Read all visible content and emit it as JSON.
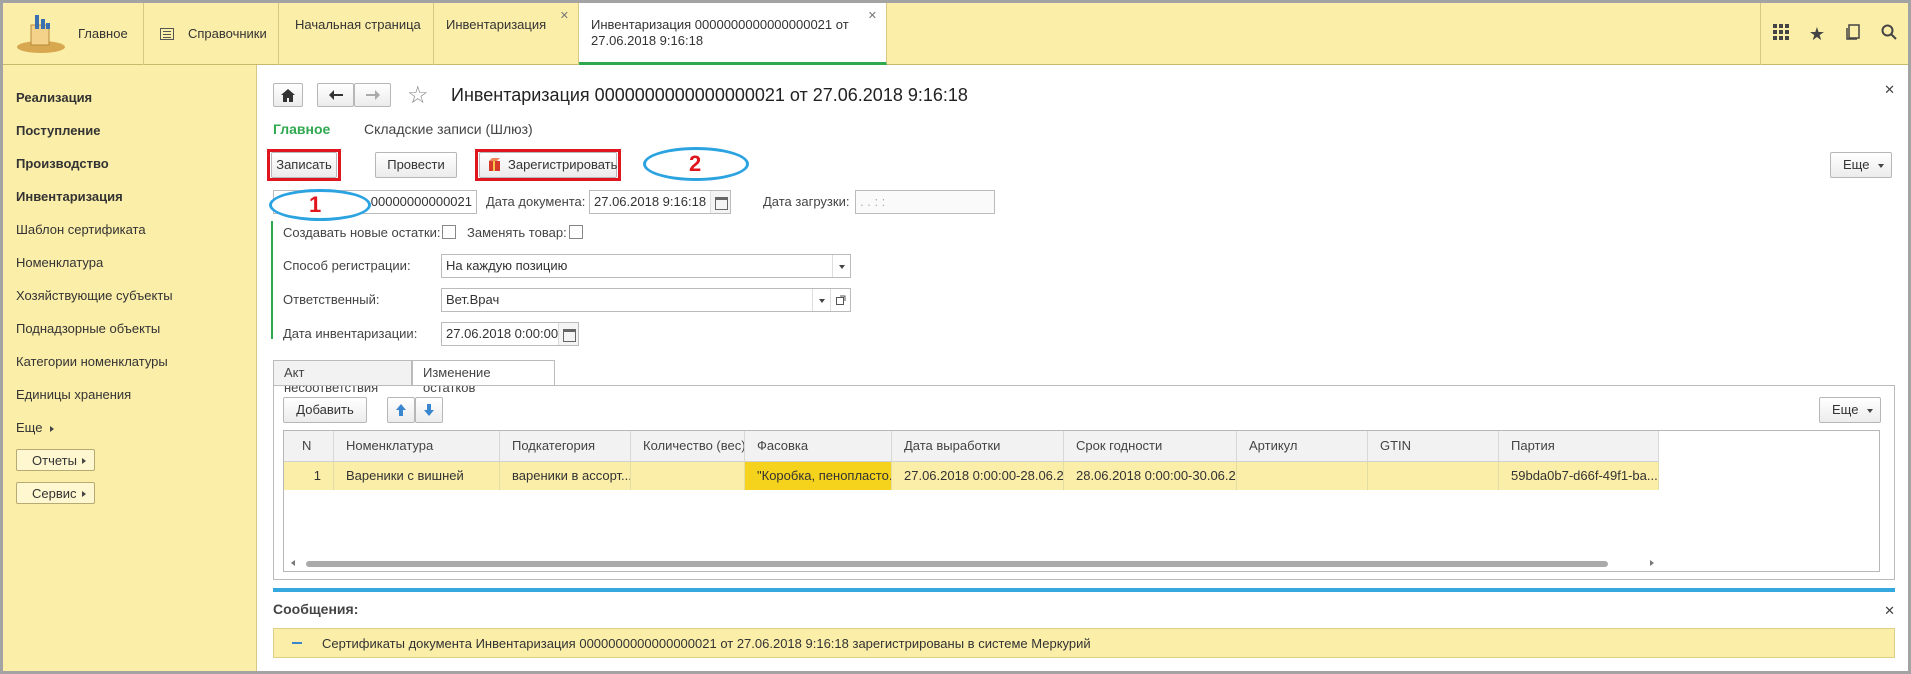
{
  "topbar": {
    "main_label": "Главное",
    "sections_label": "Справочники",
    "tabs": [
      {
        "label": "Начальная страница"
      },
      {
        "label": "Инвентаризация"
      },
      {
        "label": "Инвентаризация 0000000000000000021 от 27.06.2018 9:16:18"
      }
    ],
    "icons": [
      "grid-icon",
      "star-icon",
      "history-icon",
      "search-icon"
    ]
  },
  "sidebar": {
    "items": [
      {
        "label": "Реализация"
      },
      {
        "label": "Поступление"
      },
      {
        "label": "Производство"
      },
      {
        "label": "Инвентаризация"
      },
      {
        "label": "Шаблон сертификата"
      },
      {
        "label": "Номенклатура"
      },
      {
        "label": "Хозяйствующие субъекты"
      },
      {
        "label": "Поднадзорные объекты"
      },
      {
        "label": "Категории номенклатуры"
      },
      {
        "label": "Единицы хранения"
      },
      {
        "label": "Еще"
      }
    ],
    "reports_label": "Отчеты",
    "service_label": "Сервис"
  },
  "document": {
    "title": "Инвентаризация 0000000000000000021 от 27.06.2018 9:16:18",
    "nav_main": "Главное",
    "nav_records": "Складские записи (Шлюз)",
    "toolbar": {
      "save_label": "Записать",
      "post_label": "Провести",
      "register_label": "Зарегистрировать",
      "more_label": "Еще"
    },
    "annotations": {
      "one": "1",
      "two": "2"
    },
    "number_value": "00000000000021",
    "date_label": "Дата документа:",
    "date_value": "27.06.2018  9:16:18",
    "load_date_label": "Дата загрузки:",
    "load_date_value": " .  .       :  :",
    "create_new_label": "Создавать новые остатки:",
    "replace_label": "Заменять товар:",
    "reg_method_label": "Способ регистрации:",
    "reg_method_value": "На каждую позицию",
    "responsible_label": "Ответственный:",
    "responsible_value": "Вет.Врач",
    "inv_date_label": "Дата инвентаризации:",
    "inv_date_value": "27.06.2018  0:00:00"
  },
  "tabs": {
    "discrepancy_label": "Акт несоответствия",
    "changes_label": "Изменение остатков"
  },
  "table_toolbar": {
    "add_label": "Добавить",
    "more_label": "Еще"
  },
  "table": {
    "columns": [
      "N",
      "Номенклатура",
      "Подкатегория",
      "Количество (вес)",
      "Фасовка",
      "Дата выработки",
      "Срок годности",
      "Артикул",
      "GTIN",
      "Партия"
    ],
    "rows": [
      {
        "n": "1",
        "nomenclature": "Вареники с вишней",
        "subcategory": "вареники в ассорт...",
        "quantity": "",
        "packing": "\"Коробка, пенопласто...",
        "production_date": "27.06.2018 0:00:00-28.06.20...",
        "expiry": "28.06.2018 0:00:00-30.06.20...",
        "article": "",
        "gtin": "",
        "batch": "59bda0b7-d66f-49f1-ba..."
      }
    ]
  },
  "messages": {
    "title": "Сообщения:",
    "text": "Сертификаты документа Инвентаризация 0000000000000000021 от 27.06.2018 9:16:18 зарегистрированы в системе Меркурий"
  }
}
